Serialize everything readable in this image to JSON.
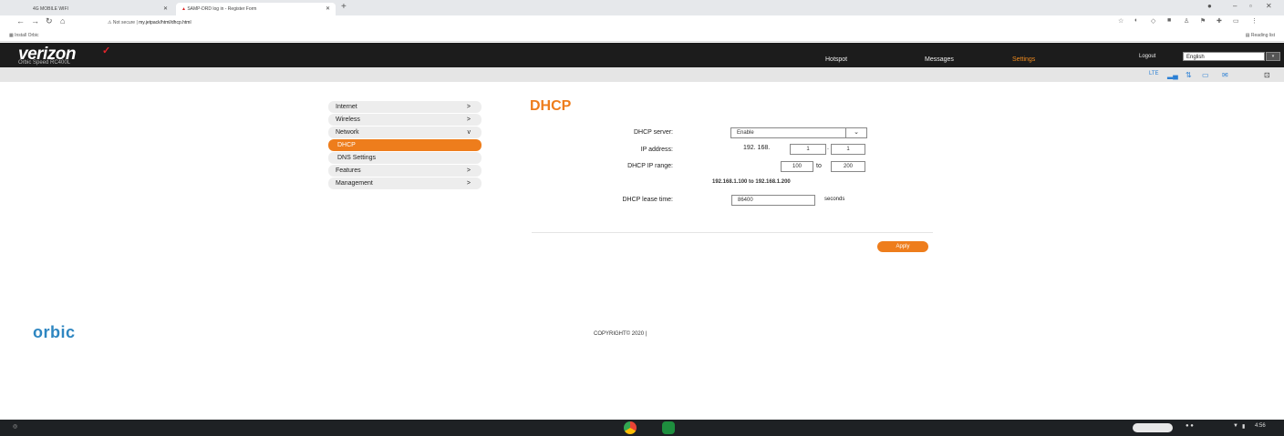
{
  "browser": {
    "tabs": [
      {
        "label": "4G MOBILE WIFI"
      },
      {
        "label": "SAMP-DRD log in - Register Form"
      }
    ],
    "new_tab_symbol": "+",
    "address_prefix": "Not secure |",
    "address_url": "my.jetpack/html/dhcp.html",
    "bookmarks_left": "Install Orbic",
    "bookmarks_right": "Reading list"
  },
  "header": {
    "brand": "verizon",
    "model": "Orbic Speed RC400L",
    "nav": [
      "Hotspot",
      "Messages",
      "Settings"
    ],
    "active_nav": "Settings",
    "logout": "Logout",
    "language": "English"
  },
  "sidebar": {
    "items": [
      {
        "label": "Internet",
        "arrow": ">"
      },
      {
        "label": "Wireless",
        "arrow": ">"
      },
      {
        "label": "Network",
        "arrow": "v"
      },
      {
        "label": "DHCP",
        "arrow": ""
      },
      {
        "label": "DNS Settings",
        "arrow": ""
      },
      {
        "label": "Features",
        "arrow": ">"
      },
      {
        "label": "Management",
        "arrow": ">"
      }
    ],
    "active_item": "DHCP"
  },
  "main": {
    "title": "DHCP",
    "dhcp_server_label": "DHCP server:",
    "dhcp_server_value": "Enable",
    "ip_address_label": "IP address:",
    "ip_prefix": "192. 168.",
    "ip_octet3": "1",
    "ip_octet4": "1",
    "range_label": "DHCP IP range:",
    "range_start": "100",
    "range_to": "to",
    "range_end": "200",
    "range_summary": "192.168.1.100 to 192.168.1.200",
    "lease_label": "DHCP lease time:",
    "lease_value": "86400",
    "lease_unit": "seconds",
    "apply_label": "Apply"
  },
  "footer": {
    "logo": "orbic",
    "copyright": "COPYRIGHT© 2020 |"
  },
  "taskbar": {
    "time": "4:56"
  },
  "colors": {
    "accent": "#ee7d1c",
    "header_bg": "#1c1c1c",
    "orbic_blue": "#2e86c1"
  }
}
